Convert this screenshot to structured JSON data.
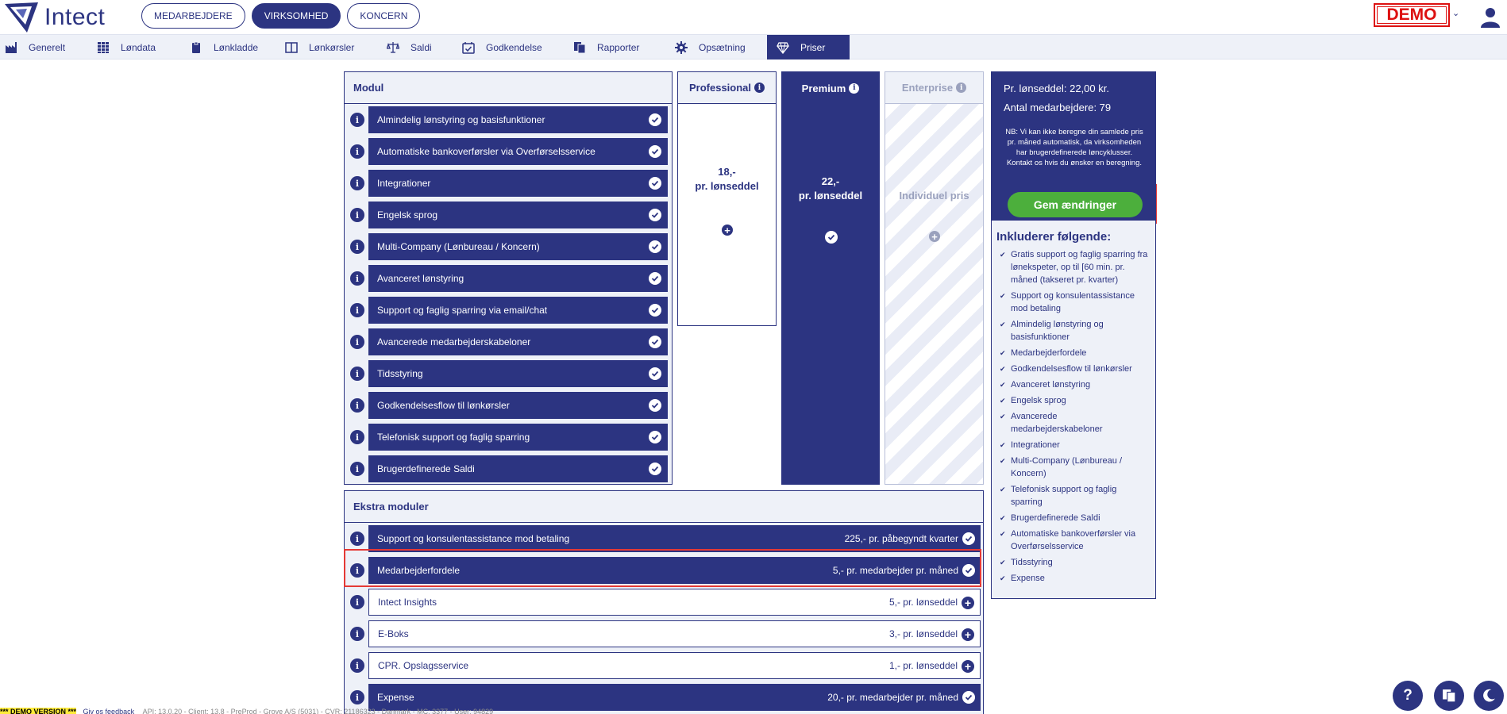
{
  "app": {
    "name": "Intect"
  },
  "top_nav": [
    {
      "label": "MEDARBEJDERE",
      "active": false
    },
    {
      "label": "VIRKSOMHED",
      "active": true
    },
    {
      "label": "KONCERN",
      "active": false
    }
  ],
  "demo_badge": "DEMO",
  "sub_nav": [
    {
      "label": "Generelt",
      "icon": "factory-icon",
      "active": false
    },
    {
      "label": "Løndata",
      "icon": "grid-icon",
      "active": false
    },
    {
      "label": "Lønkladde",
      "icon": "clipboard-icon",
      "active": false
    },
    {
      "label": "Lønkørsler",
      "icon": "book-icon",
      "active": false
    },
    {
      "label": "Saldi",
      "icon": "scale-icon",
      "active": false
    },
    {
      "label": "Godkendelse",
      "icon": "calendar-check-icon",
      "active": false
    },
    {
      "label": "Rapporter",
      "icon": "copy-icon",
      "active": false
    },
    {
      "label": "Opsætning",
      "icon": "gear-icon",
      "active": false
    },
    {
      "label": "Priser",
      "icon": "diamond-icon",
      "active": true
    }
  ],
  "modul": {
    "title": "Modul",
    "rows": [
      "Almindelig lønstyring og basisfunktioner",
      "Automatiske bankoverførsler via Overførselsservice",
      "Integrationer",
      "Engelsk sprog",
      "Multi-Company (Lønbureau / Koncern)",
      "Avanceret lønstyring",
      "Support og faglig sparring via email/chat",
      "Avancerede medarbejderskabeloner",
      "Tidsstyring",
      "Godkendelsesflow til lønkørsler",
      "Telefonisk support og faglig sparring",
      "Brugerdefinerede Saldi"
    ]
  },
  "plans": {
    "professional": {
      "name": "Professional",
      "price_line1": "18,-",
      "price_line2": "pr. lønseddel"
    },
    "premium": {
      "name": "Premium",
      "price_line1": "22,-",
      "price_line2": "pr. lønseddel"
    },
    "enterprise": {
      "name": "Enterprise",
      "price_text": "Individuel pris"
    }
  },
  "ekstra": {
    "title": "Ekstra moduler",
    "rows": [
      {
        "label": "Support og konsulentassistance mod betaling",
        "price": "225,- pr. påbegyndt kvarter",
        "active": true
      },
      {
        "label": "Medarbejderfordele",
        "price": "5,- pr. medarbejder pr. måned",
        "active": true
      },
      {
        "label": "Intect Insights",
        "price": "5,- pr. lønseddel",
        "active": false
      },
      {
        "label": "E-Boks",
        "price": "3,- pr. lønseddel",
        "active": false
      },
      {
        "label": "CPR. Opslagsservice",
        "price": "1,- pr. lønseddel",
        "active": false
      },
      {
        "label": "Expense",
        "price": "20,- pr. medarbejder pr. måned",
        "active": true
      }
    ]
  },
  "summary": {
    "price_per_slip": "Pr. lønseddel: 22,00 kr.",
    "employee_count": "Antal medarbejdere: 79",
    "note": "NB: Vi kan ikke beregne din samlede pris pr. måned automatisk, da virksomheden har brugerdefinerede løncyklusser. Kontakt os hvis du ønsker en beregning.",
    "save_label": "Gem ændringer",
    "includes_title": "Inkluderer følgende:",
    "includes": [
      "Gratis support og faglig sparring fra lønekspeter, op til [60 min. pr. måned (takseret pr. kvarter)",
      "Support og konsulentassistance mod betaling",
      "Almindelig lønstyring og basisfunktioner",
      "Medarbejderfordele",
      "Godkendelsesflow til lønkørsler",
      "Avanceret lønstyring",
      "Engelsk sprog",
      "Avancerede medarbejderskabeloner",
      "Integrationer",
      "Multi-Company (Lønbureau / Koncern)",
      "Telefonisk support og faglig sparring",
      "Brugerdefinerede Saldi",
      "Automatiske bankoverførsler via Overførselsservice",
      "Tidsstyring",
      "Expense"
    ]
  },
  "footer": {
    "demo_version": "*** DEMO VERSION ***",
    "feedback": "Giv os feedback",
    "meta": "API: 13.0.20 - Client: 13.8 - PreProd - Grove A/S (5031) - CVR: 21186323 - Danmark - MC: 3377 - User: 94829"
  },
  "fabs": {
    "help": "?"
  },
  "colors": {
    "primary": "#2c3481",
    "light": "#eef1f8",
    "accent_green": "#4caf3c",
    "highlight_red": "#e53935"
  }
}
